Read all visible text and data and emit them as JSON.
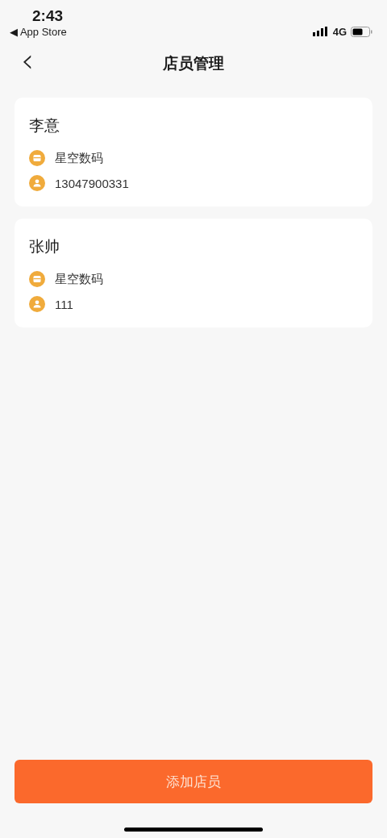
{
  "status_bar": {
    "time": "2:43",
    "back_app": "◀ App Store",
    "network": "4G"
  },
  "nav": {
    "back": "‹",
    "title": "店员管理"
  },
  "staff": [
    {
      "name": "李意",
      "store": "星空数码",
      "phone": "13047900331"
    },
    {
      "name": "张帅",
      "store": "星空数码",
      "phone": "111"
    }
  ],
  "add_button": "添加店员"
}
